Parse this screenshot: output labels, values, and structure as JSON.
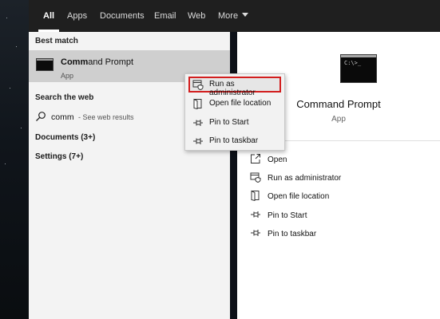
{
  "tabs": [
    {
      "label": "All",
      "active": true
    },
    {
      "label": "Apps"
    },
    {
      "label": "Documents"
    },
    {
      "label": "Email"
    },
    {
      "label": "Web"
    },
    {
      "label": "More"
    }
  ],
  "results": {
    "best_match_header": "Best match",
    "best_match": {
      "title_bold": "Comm",
      "title_rest": "and Prompt",
      "subtitle": "App"
    },
    "search_web_header": "Search the web",
    "web_query": "comm",
    "web_hint": "- See web results",
    "documents": "Documents (3+)",
    "settings": "Settings (7+)"
  },
  "context_menu": {
    "items": [
      {
        "label": "Run as administrator",
        "icon": "run-as-admin-icon",
        "highlighted": true
      },
      {
        "label": "Open file location",
        "icon": "open-file-location-icon"
      },
      {
        "label": "Pin to Start",
        "icon": "pin-icon"
      },
      {
        "label": "Pin to taskbar",
        "icon": "pin-icon"
      }
    ]
  },
  "details": {
    "app_title": "Command Prompt",
    "app_type": "App",
    "actions": [
      {
        "label": "Open",
        "icon": "open-icon"
      },
      {
        "label": "Run as administrator",
        "icon": "run-as-admin-icon"
      },
      {
        "label": "Open file location",
        "icon": "open-file-location-icon"
      },
      {
        "label": "Pin to Start",
        "icon": "pin-icon"
      },
      {
        "label": "Pin to taskbar",
        "icon": "pin-icon"
      }
    ]
  },
  "colors": {
    "topbar": "#1f1f1f",
    "left_pane": "#f3f3f3",
    "selection": "#cfcfcf",
    "highlight_border": "#d21e1e"
  }
}
